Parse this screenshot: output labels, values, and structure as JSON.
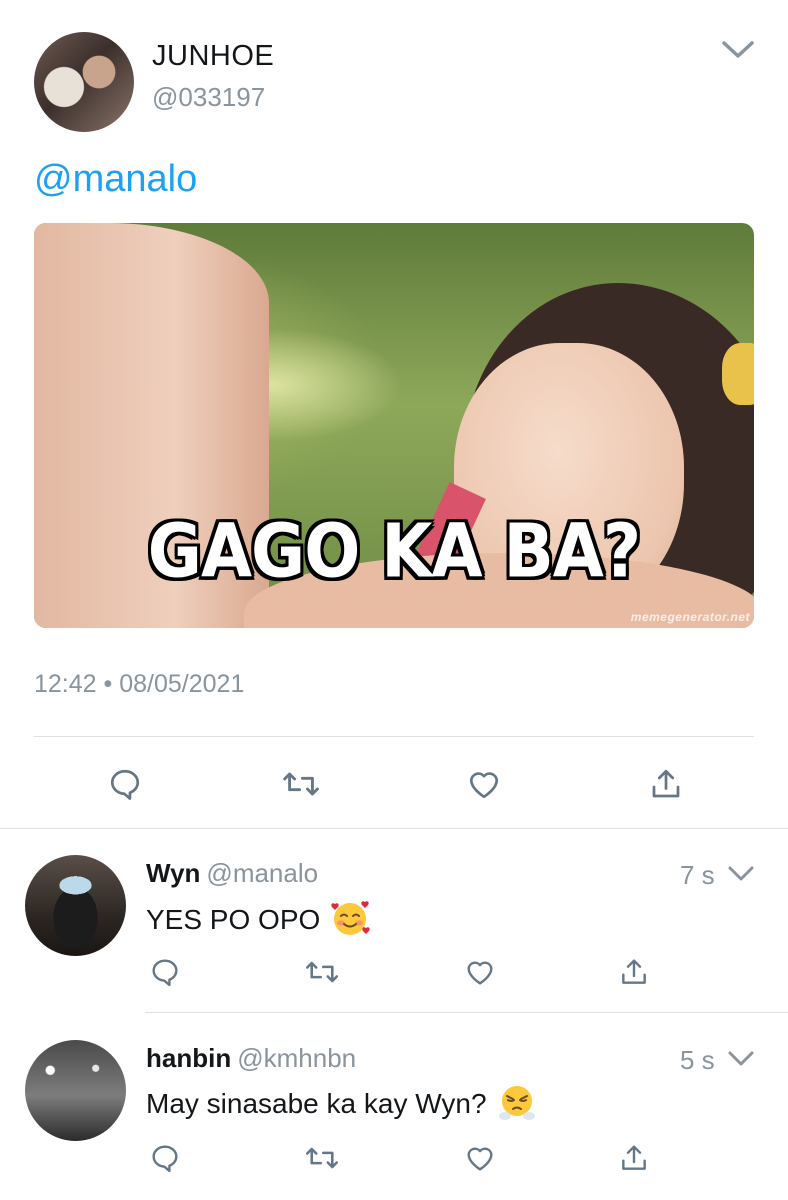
{
  "tweet": {
    "author_name": "JUNHOE",
    "author_handle": "@033197",
    "text_mention": "@manalo",
    "meme_caption": "GAGO KA BA?",
    "watermark": "memegenerator.net",
    "time": "12:42",
    "separator": "•",
    "date": "08/05/2021"
  },
  "actions": {
    "reply": "reply-icon",
    "retweet": "retweet-icon",
    "like": "heart-icon",
    "share": "share-icon"
  },
  "replies": [
    {
      "name": "Wyn",
      "handle": "@manalo",
      "time": "7 s",
      "text": "YES PO OPO",
      "emoji": "smiling-face-with-hearts"
    },
    {
      "name": "hanbin",
      "handle": "@kmhnbn",
      "time": "5 s",
      "text": "May sinasabe ka kay Wyn?",
      "emoji": "face-with-steam-from-nose"
    }
  ],
  "colors": {
    "link": "#1da1f2",
    "secondary_text": "#8a949d",
    "icon": "#657786",
    "divider": "#dde1e4"
  }
}
